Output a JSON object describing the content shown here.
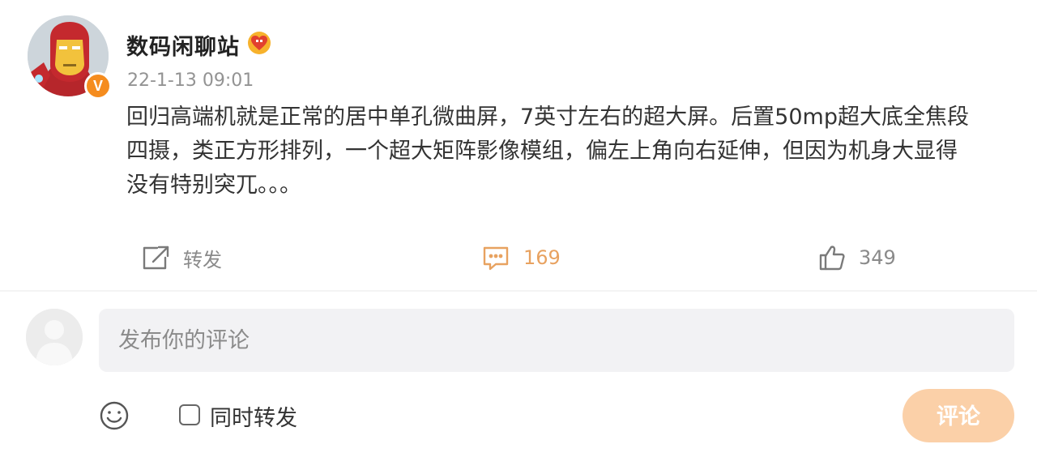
{
  "post": {
    "username": "数码闲聊站",
    "timestamp": "22-1-13 09:01",
    "verified_badge": "V",
    "content_lines": [
      "回归高端机就是正常的居中单孔微曲屏，7英寸左右的超大屏。后置50mp超大底全焦段",
      "四摄，类正方形排列，一个超大矩阵影像模组，偏左上角向右延伸，但因为机身大显得",
      "没有特别突兀。。。"
    ],
    "actions": {
      "forward_label": "转发",
      "comment_count": "169",
      "like_count": "349"
    }
  },
  "composer": {
    "placeholder": "发布你的评论",
    "repost_label": "同时转发",
    "submit_label": "评论"
  },
  "colors": {
    "accent_orange": "#f58c1e",
    "submit_bg": "#fbd0a8",
    "comment_icon": "#e8a260"
  },
  "icons": [
    "forward-icon",
    "comment-icon",
    "like-icon",
    "emoji-icon",
    "vip-heart-icon",
    "verified-badge-icon"
  ]
}
